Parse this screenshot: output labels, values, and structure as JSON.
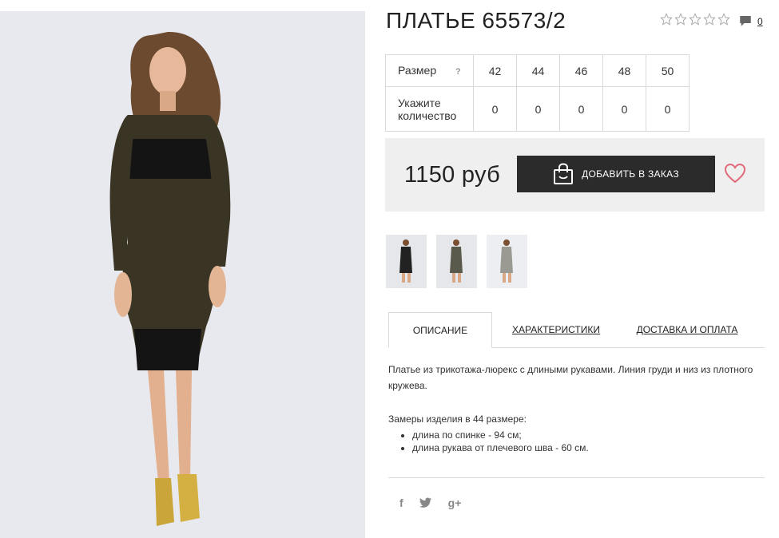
{
  "product": {
    "title": "ПЛАТЬЕ 65573/2",
    "rating_stars": 5,
    "comments_count": "0"
  },
  "size_table": {
    "size_label": "Размер",
    "help_label": "?",
    "sizes": [
      "42",
      "44",
      "46",
      "48",
      "50"
    ],
    "qty_label": "Укажите количество",
    "quantities": [
      "0",
      "0",
      "0",
      "0",
      "0"
    ]
  },
  "purchase": {
    "price": "1150 руб",
    "order_button": "ДОБАВИТЬ В ЗАКАЗ"
  },
  "tabs": {
    "description": "ОПИСАНИЕ",
    "characteristics": "ХАРАКТЕРИСТИКИ",
    "delivery": "ДОСТАВКА И ОПЛАТА"
  },
  "description": {
    "text": "Платье из трикотажа-люрекс с длиными рукавами. Линия груди и низ из плотного кружева.",
    "measurements_title": "Замеры изделия в 44 размере:",
    "measurements": [
      "длина по спинке - 94 см;",
      "длина рукава от плечевого шва - 60 см."
    ]
  },
  "social": {
    "facebook": "f",
    "twitter": "twitter-icon",
    "googleplus": "g+"
  },
  "colors": {
    "accent_heart": "#e06a7a",
    "button_bg": "#2b2b2b",
    "price_box_bg": "#efefef"
  }
}
